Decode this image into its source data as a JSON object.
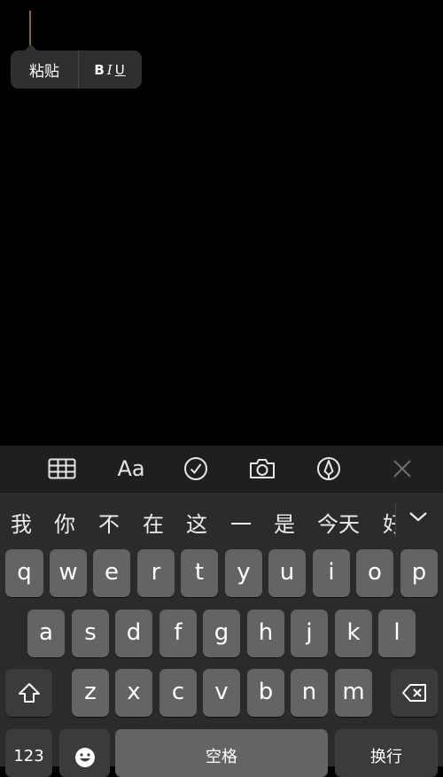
{
  "edit_menu": {
    "paste_label": "粘贴",
    "bold": "B",
    "italic": "I",
    "underline": "U"
  },
  "toolbar": {
    "text_format_label": "Aa",
    "icons": [
      "table-icon",
      "text-format-icon",
      "checklist-icon",
      "camera-icon",
      "markup-pen-icon",
      "close-icon"
    ]
  },
  "candidates": {
    "items": [
      "我",
      "你",
      "不",
      "在",
      "这",
      "一",
      "是",
      "今天"
    ],
    "partial": "好"
  },
  "keyboard": {
    "row1": [
      "q",
      "w",
      "e",
      "r",
      "t",
      "y",
      "u",
      "i",
      "o",
      "p"
    ],
    "row2": [
      "a",
      "s",
      "d",
      "f",
      "g",
      "h",
      "j",
      "k",
      "l"
    ],
    "row3": [
      "z",
      "x",
      "c",
      "v",
      "b",
      "n",
      "m"
    ],
    "numbers_label": "123",
    "space_label": "空格",
    "return_label": "换行"
  },
  "colors": {
    "key_light": "#646466",
    "key_dark": "#3b3b3d",
    "keyboard_bg": "#2b2b2d",
    "cursor": "#8a6a2c"
  }
}
